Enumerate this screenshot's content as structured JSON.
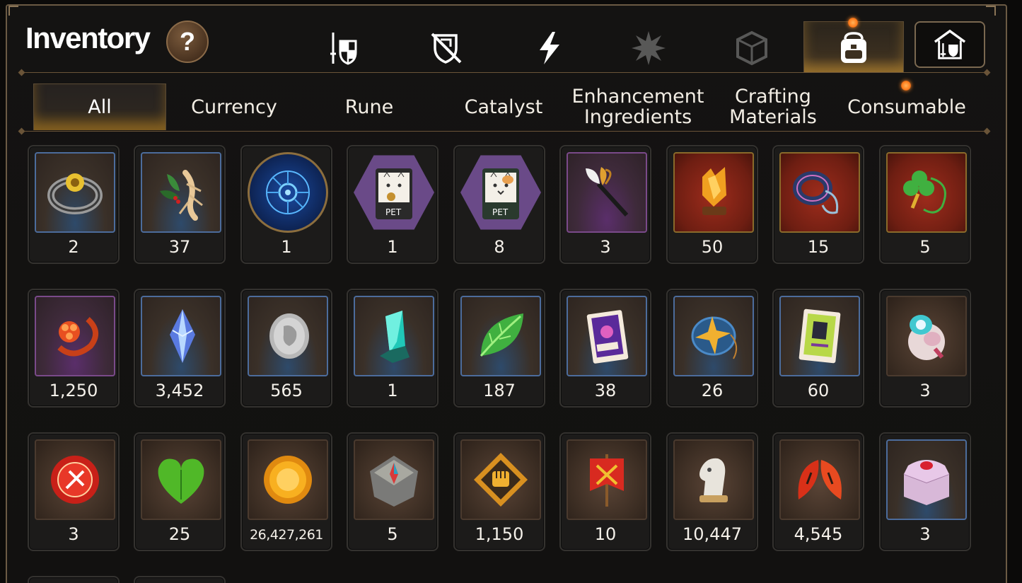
{
  "header": {
    "title": "Inventory",
    "help_label": "?"
  },
  "top_tabs": [
    {
      "name": "equipment",
      "icon": "sword-shield-icon",
      "active": false
    },
    {
      "name": "artifact",
      "icon": "crossed-shield-icon",
      "active": false
    },
    {
      "name": "skill",
      "icon": "lightning-icon",
      "active": false
    },
    {
      "name": "locked-1",
      "icon": "burst-icon",
      "active": false,
      "disabled": true
    },
    {
      "name": "locked-2",
      "icon": "cube-icon",
      "active": false,
      "disabled": true
    },
    {
      "name": "inventory",
      "icon": "backpack-icon",
      "active": true
    },
    {
      "name": "storage",
      "icon": "house-shield-icon",
      "active": false
    }
  ],
  "sub_tabs": [
    {
      "label": "All",
      "active": true
    },
    {
      "label": "Currency",
      "active": false
    },
    {
      "label": "Rune",
      "active": false
    },
    {
      "label": "Catalyst",
      "active": false
    },
    {
      "label": "Enhancement\nIngredients",
      "active": false
    },
    {
      "label": "Crafting\nMaterials",
      "active": false
    },
    {
      "label": "Consumable",
      "active": false
    }
  ],
  "items": [
    {
      "icon": "ring-icon",
      "count": "2",
      "rarity": "blue"
    },
    {
      "icon": "ginseng-root-icon",
      "count": "37",
      "rarity": "blue"
    },
    {
      "icon": "blue-rune-orb-icon",
      "count": "1",
      "rarity": "round"
    },
    {
      "icon": "pet-pack-premium-icon",
      "count": "1",
      "rarity": "hex"
    },
    {
      "icon": "pet-pack-icon",
      "count": "8",
      "rarity": "hex"
    },
    {
      "icon": "feather-wand-icon",
      "count": "3",
      "rarity": "purple"
    },
    {
      "icon": "crystal-trophy-icon",
      "count": "50",
      "rarity": "red"
    },
    {
      "icon": "charm-bracelet-icon",
      "count": "15",
      "rarity": "red"
    },
    {
      "icon": "clover-necklace-icon",
      "count": "5",
      "rarity": "red"
    },
    {
      "icon": "flower-ring-icon",
      "count": "1,250",
      "rarity": "purple"
    },
    {
      "icon": "blue-crystal-icon",
      "count": "3,452",
      "rarity": "blue"
    },
    {
      "icon": "silver-coin-icon",
      "count": "565",
      "rarity": "blue"
    },
    {
      "icon": "teal-crystal-icon",
      "count": "1",
      "rarity": "blue"
    },
    {
      "icon": "green-leaf-icon",
      "count": "187",
      "rarity": "blue"
    },
    {
      "icon": "purple-card-icon",
      "count": "38",
      "rarity": "blue"
    },
    {
      "icon": "star-pendant-icon",
      "count": "26",
      "rarity": "blue"
    },
    {
      "icon": "green-card-icon",
      "count": "60",
      "rarity": "blue"
    },
    {
      "icon": "robot-egg-icon",
      "count": "3",
      "rarity": "brown"
    },
    {
      "icon": "red-badge-icon",
      "count": "3",
      "rarity": "brown"
    },
    {
      "icon": "green-heart-icon",
      "count": "25",
      "rarity": "brown"
    },
    {
      "icon": "gold-coin-icon",
      "count": "26,427,261",
      "rarity": "brown"
    },
    {
      "icon": "compass-stone-icon",
      "count": "5",
      "rarity": "brown"
    },
    {
      "icon": "fist-emblem-icon",
      "count": "1,150",
      "rarity": "brown"
    },
    {
      "icon": "battle-banner-icon",
      "count": "10",
      "rarity": "brown"
    },
    {
      "icon": "chess-knight-icon",
      "count": "10,447",
      "rarity": "brown"
    },
    {
      "icon": "red-leaves-icon",
      "count": "4,545",
      "rarity": "brown"
    },
    {
      "icon": "jewel-box-icon",
      "count": "3",
      "rarity": "blue"
    }
  ],
  "colors": {
    "accent_gold": "#e0a23c",
    "frame_border": "#6b5a44",
    "rarity_blue": "#4c6c9c",
    "rarity_purple": "#7a4a8a",
    "rarity_red": "#9e2c1c"
  }
}
